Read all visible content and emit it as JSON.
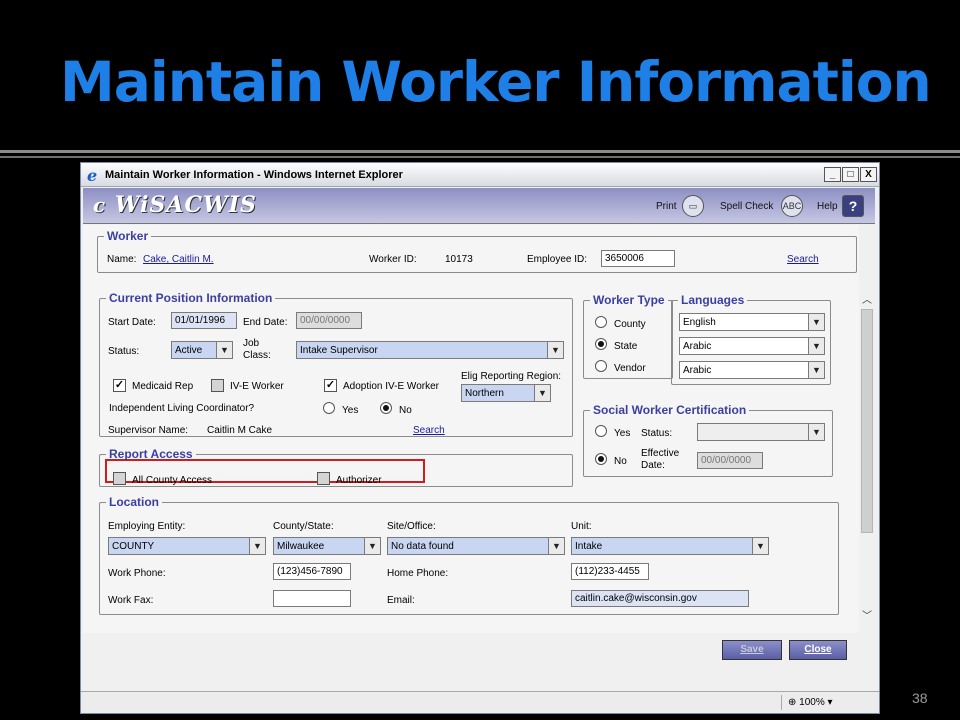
{
  "slide": {
    "title": "Maintain Worker Information",
    "page_number": "38"
  },
  "window": {
    "title": "Maintain Worker Information - Windows Internet Explorer",
    "min": "_",
    "max": "□",
    "close": "X"
  },
  "header": {
    "logo": "eWiSACWIS",
    "print": "Print",
    "spell_check": "Spell Check",
    "help": "Help"
  },
  "worker": {
    "legend": "Worker",
    "name_label": "Name:",
    "name": "Cake, Caitlin M.",
    "worker_id_label": "Worker ID:",
    "worker_id": "10173",
    "employee_id_label": "Employee ID:",
    "employee_id": "3650006",
    "search": "Search"
  },
  "position": {
    "legend": "Current Position Information",
    "start_date_label": "Start Date:",
    "start_date": "01/01/1996",
    "end_date_label": "End Date:",
    "end_date": "00/00/0000",
    "status_label": "Status:",
    "status": "Active",
    "job_class_label": "Job\nClass:",
    "job_class": "Intake Supervisor",
    "medicaid_rep": "Medicaid Rep",
    "ive_worker": "IV-E Worker",
    "adoption_ive_worker": "Adoption IV-E Worker",
    "elig_region_label": "Elig Reporting Region:",
    "elig_region": "Northern",
    "ilc_label": "Independent Living Coordinator?",
    "ilc_yes": "Yes",
    "ilc_no": "No",
    "ilc_selected": "No",
    "supervisor_label": "Supervisor Name:",
    "supervisor": "Caitlin M Cake",
    "search": "Search"
  },
  "worker_type": {
    "legend": "Worker Type",
    "options": [
      "County",
      "State",
      "Vendor"
    ],
    "selected": "State"
  },
  "languages": {
    "legend": "Languages",
    "values": [
      "English",
      "Arabic",
      "Arabic"
    ]
  },
  "social_cert": {
    "legend": "Social Worker Certification",
    "yes": "Yes",
    "no": "No",
    "selected": "No",
    "status_label": "Status:",
    "status": "",
    "effective_label": "Effective\nDate:",
    "effective_date": "00/00/0000"
  },
  "report_access": {
    "legend": "Report Access",
    "all_county": "All County Access",
    "authorizer": "Authorizer"
  },
  "location": {
    "legend": "Location",
    "entity_label": "Employing Entity:",
    "entity": "COUNTY",
    "county_label": "County/State:",
    "county": "Milwaukee",
    "site_label": "Site/Office:",
    "site": "No data found",
    "unit_label": "Unit:",
    "unit": "Intake",
    "work_phone_label": "Work Phone:",
    "work_phone": "(123)456-7890",
    "home_phone_label": "Home Phone:",
    "home_phone": "(112)233-4455",
    "work_fax_label": "Work Fax:",
    "work_fax": "",
    "email_label": "Email:",
    "email": "caitlin.cake@wisconsin.gov"
  },
  "buttons": {
    "save": "Save",
    "close": "Close"
  },
  "status_bar": {
    "zoom": "100%"
  }
}
